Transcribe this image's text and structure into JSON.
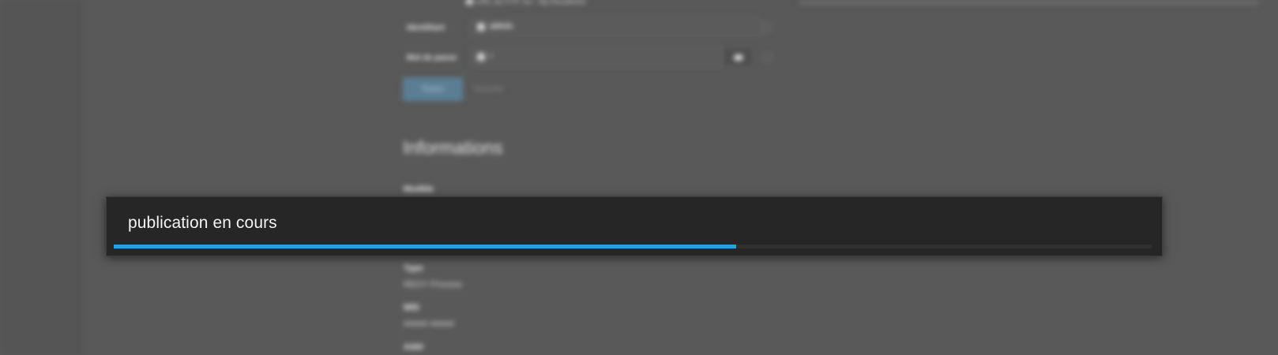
{
  "background": {
    "connection_hint": "URL du FTP. Ex : ftp://localhost",
    "fields": [
      {
        "label": "Identifiant",
        "value": "admin",
        "icon": "user-icon"
      },
      {
        "label": "Mot de passe",
        "value": "•",
        "icon": "lock-icon"
      }
    ],
    "test_button_label": "Tester",
    "cancel_button_label": "Annuler",
    "section_title": "Informations",
    "info": [
      {
        "key": "Modèle",
        "value": ""
      },
      {
        "key": "Type",
        "value": "REOY Process"
      },
      {
        "key": "MID",
        "value": "##### #####"
      },
      {
        "key": "Addr",
        "value": ""
      }
    ]
  },
  "dialog": {
    "message": "publication en cours",
    "progress": 0.6,
    "colors": {
      "progress_fill": "#2d9fd9",
      "background": "#262626"
    }
  }
}
